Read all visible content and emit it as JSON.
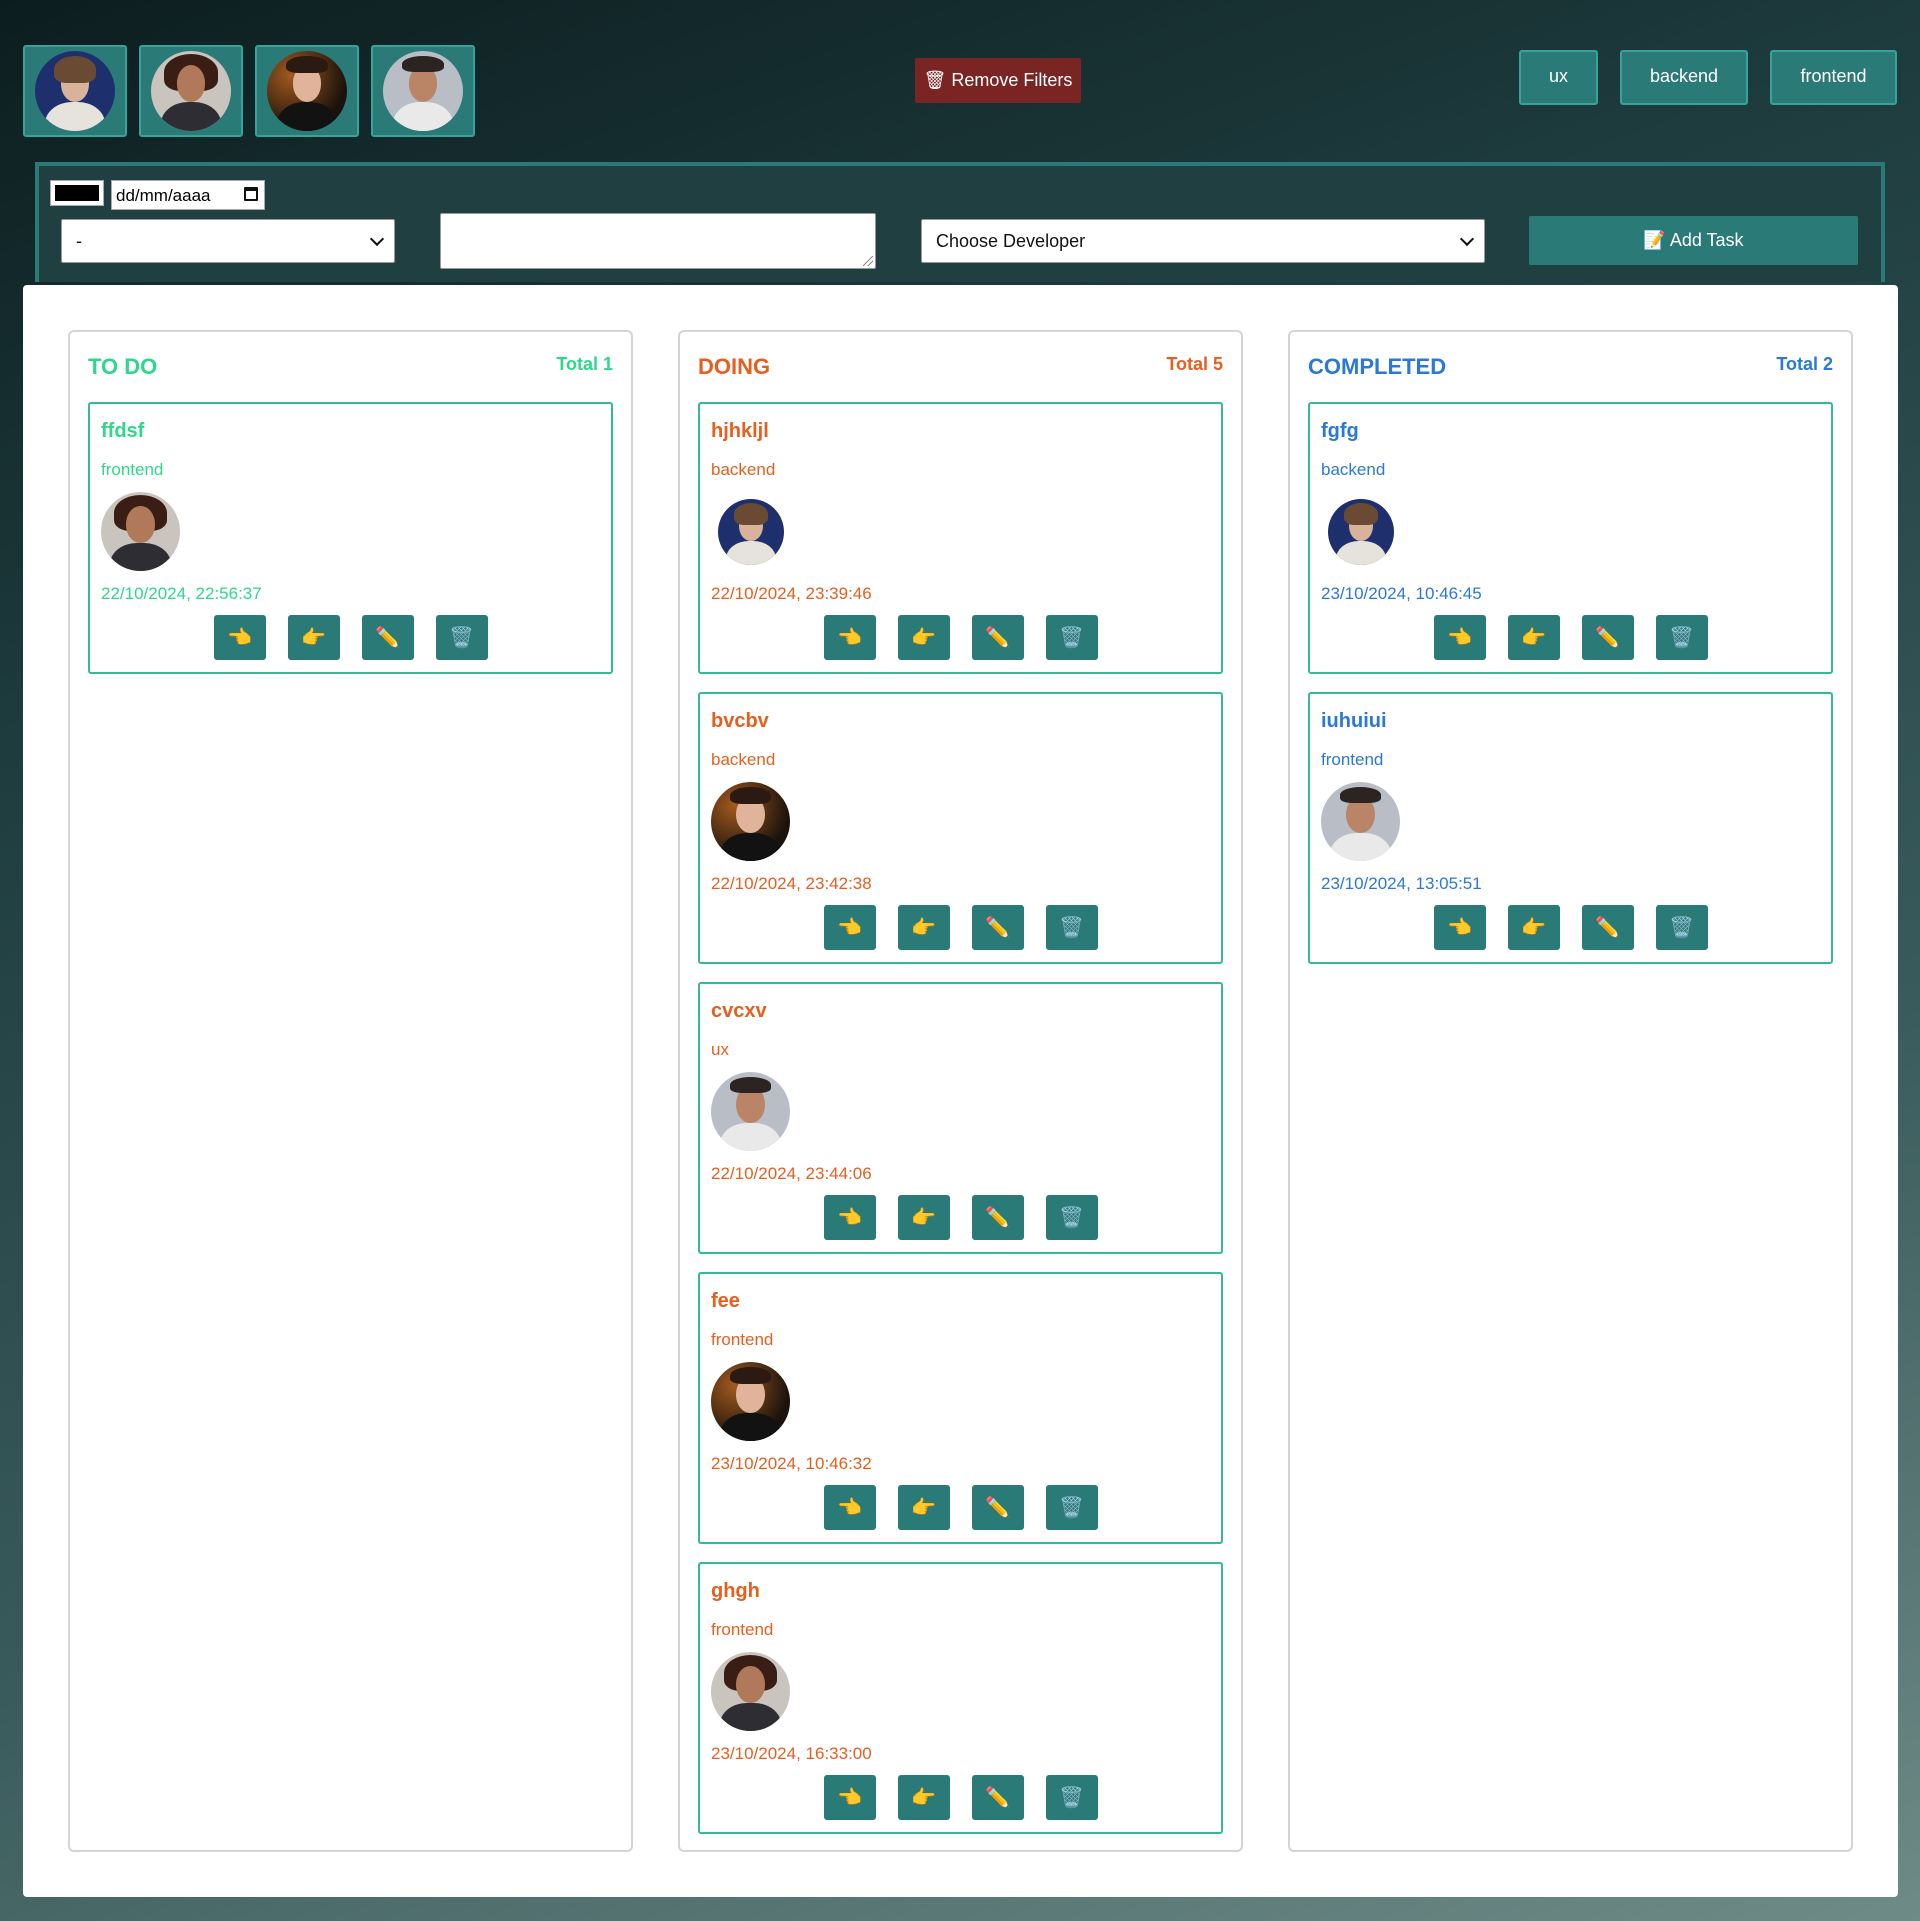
{
  "header": {
    "remove_filters_label": "🗑 Remove Filters",
    "tags": [
      "ux",
      "backend",
      "frontend"
    ],
    "developers": [
      "dev-1",
      "dev-2",
      "dev-3",
      "dev-4"
    ]
  },
  "form": {
    "color_value": "#000000",
    "date_placeholder": "dd/mm/aaaa",
    "type_select_value": "-",
    "description_value": "",
    "developer_select_value": "Choose Developer",
    "add_task_label": "📝 Add Task"
  },
  "columns": {
    "todo": {
      "title": "TO DO",
      "total": "Total 1",
      "color": "#2ed88a"
    },
    "doing": {
      "title": "DOING",
      "total": "Total 5",
      "color": "#e65f1f"
    },
    "completed": {
      "title": "COMPLETED",
      "total": "Total 2",
      "color": "#2a78d9"
    }
  },
  "cards": {
    "todo": [
      {
        "title": "ffdsf",
        "tag": "frontend",
        "developer": "dev-2",
        "date": "22/10/2024, 22:56:37"
      }
    ],
    "doing": [
      {
        "title": "hjhkljl",
        "tag": "backend",
        "developer": "dev-1",
        "date": "22/10/2024, 23:39:46"
      },
      {
        "title": "bvcbv",
        "tag": "backend",
        "developer": "dev-3",
        "date": "22/10/2024, 23:42:38"
      },
      {
        "title": "cvcxv",
        "tag": "ux",
        "developer": "dev-4",
        "date": "22/10/2024, 23:44:06"
      },
      {
        "title": "fee",
        "tag": "frontend",
        "developer": "dev-3",
        "date": "23/10/2024, 10:46:32"
      },
      {
        "title": "ghgh",
        "tag": "frontend",
        "developer": "dev-2",
        "date": "23/10/2024, 16:33:00"
      }
    ],
    "completed": [
      {
        "title": "fgfg",
        "tag": "backend",
        "developer": "dev-1",
        "date": "23/10/2024, 10:46:45"
      },
      {
        "title": "iuhuiui",
        "tag": "frontend",
        "developer": "dev-4",
        "date": "23/10/2024, 13:05:51"
      }
    ]
  },
  "actions": [
    {
      "name": "move-left-button",
      "icon": "👈"
    },
    {
      "name": "move-right-button",
      "icon": "👉"
    },
    {
      "name": "edit-button",
      "icon": "✏️"
    },
    {
      "name": "delete-button",
      "icon": "🗑️"
    }
  ],
  "colors": {
    "accent": "#2a7a78",
    "danger": "#7a2424",
    "card_border": "#34b99a"
  }
}
